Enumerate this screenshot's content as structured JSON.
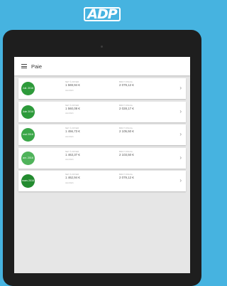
{
  "brand": {
    "logo_text": "ADP"
  },
  "appbar": {
    "title": "Paie"
  },
  "labels": {
    "net": "NET À PAYER",
    "brut": "BRUT FISCAL",
    "hours": "HEURES"
  },
  "payslips": [
    {
      "period": "Juil. 2016",
      "color": "#2d9a3a",
      "net": "1 569,94 €",
      "brut": "2 079,12 €"
    },
    {
      "period": "Juin 2016",
      "color": "#2d9a3a",
      "net": "1 560,08 €",
      "brut": "2 028,17 €"
    },
    {
      "period": "mai 2016",
      "color": "#3aa648",
      "net": "1 456,73 €",
      "brut": "2 105,50 €"
    },
    {
      "period": "avr. 2016",
      "color": "#4fb35a",
      "net": "1 463,37 €",
      "brut": "2 103,50 €"
    },
    {
      "period": "mars 2016",
      "color": "#238b2f",
      "net": "1 462,94 €",
      "brut": "2 079,12 €"
    }
  ]
}
